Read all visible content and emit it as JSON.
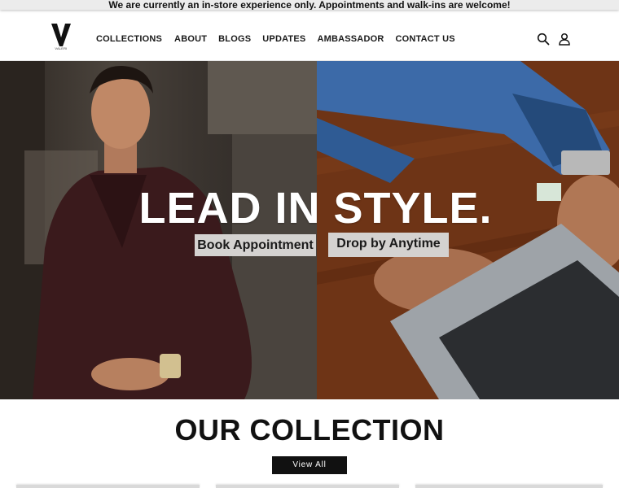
{
  "announcement": {
    "text": "We are currently an in-store experience only. Appointments and walk-ins are welcome!"
  },
  "header": {
    "logo_letter": "V",
    "logo_sub": "VALERI",
    "nav": [
      {
        "label": "COLLECTIONS"
      },
      {
        "label": "ABOUT"
      },
      {
        "label": "BLOGS"
      },
      {
        "label": "UPDATES"
      },
      {
        "label": "AMBASSADOR"
      },
      {
        "label": "CONTACT US"
      }
    ],
    "icons": {
      "search": "search-icon",
      "account": "account-icon"
    }
  },
  "hero": {
    "title": "LEAD IN STYLE.",
    "buttons": {
      "book": "Book Appointment",
      "drop": "Drop by Anytime"
    },
    "colors": {
      "left_image": "#3b3530",
      "right_image": "#6e3416",
      "button_bg": "#d4d2d0"
    }
  },
  "collection": {
    "heading": "OUR COLLECTION",
    "view_all": "View All"
  }
}
